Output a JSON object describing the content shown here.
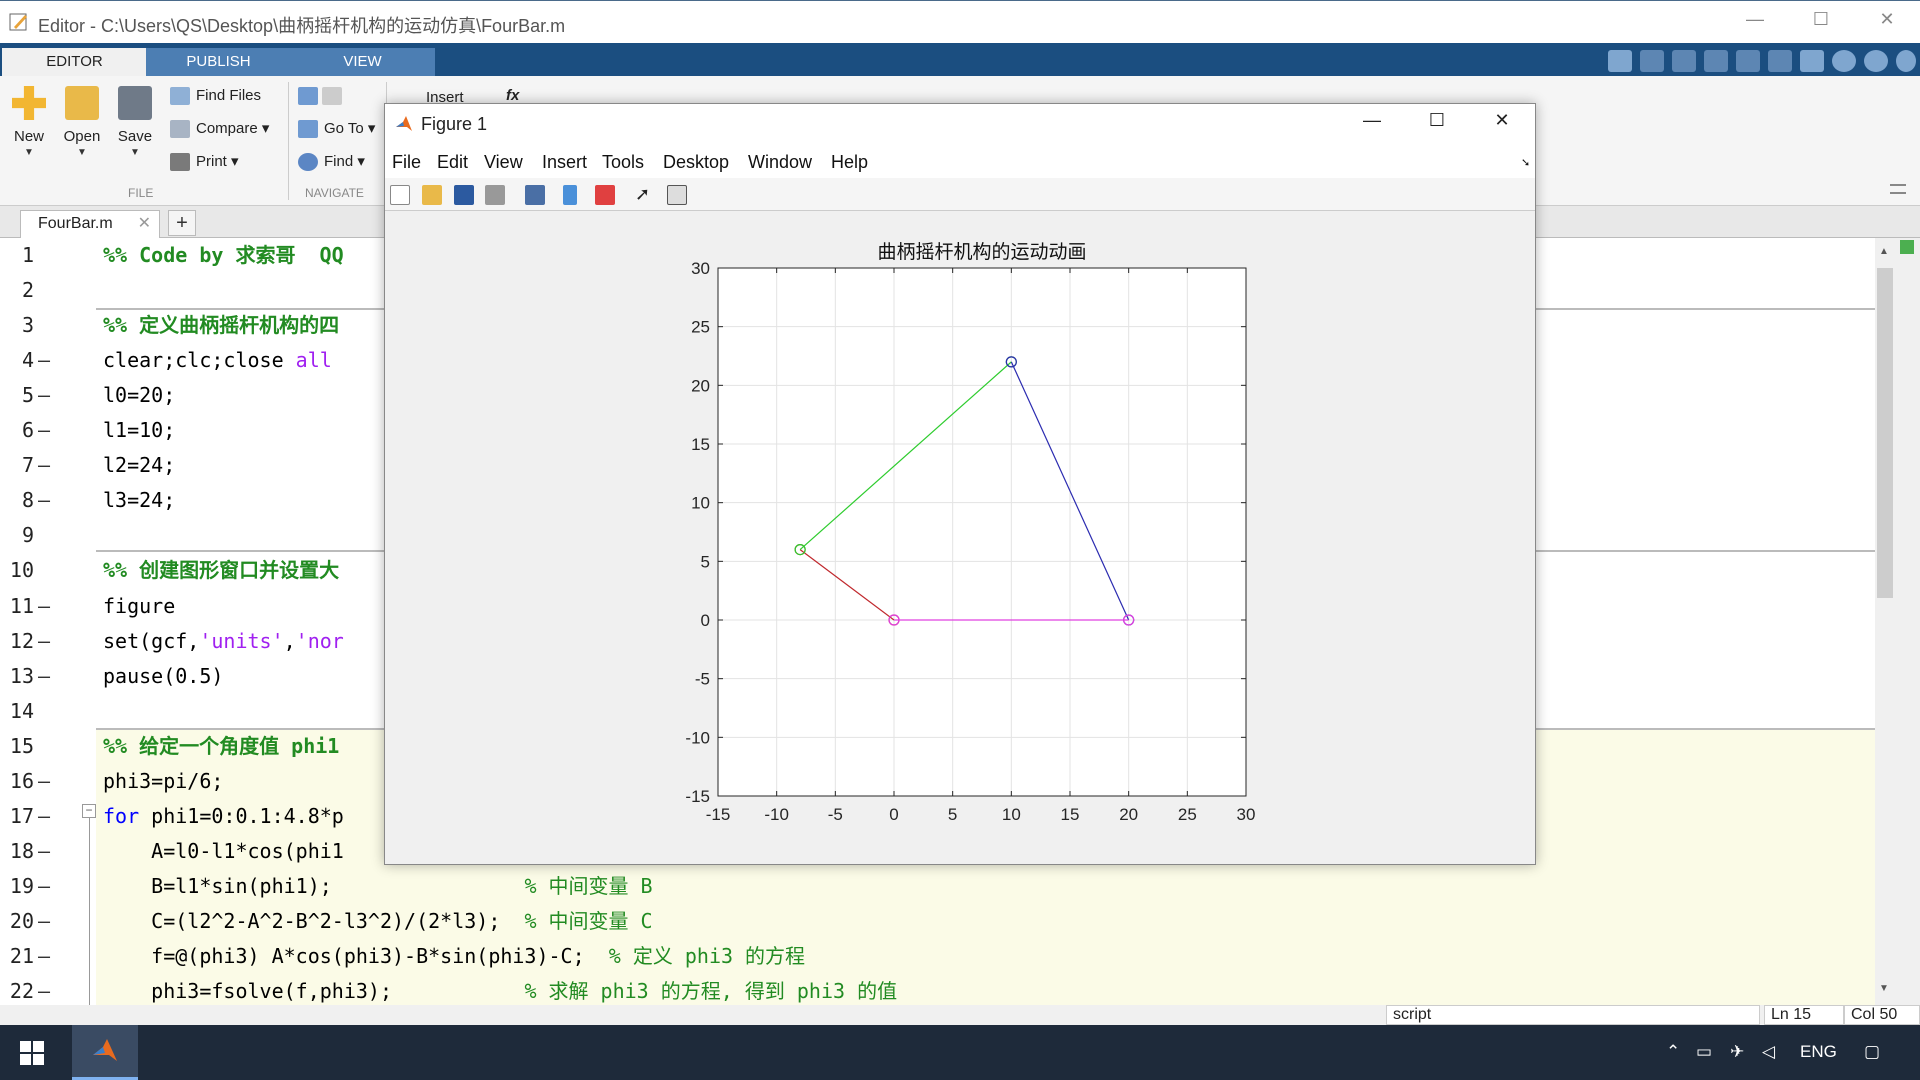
{
  "window": {
    "title": "Editor - C:\\Users\\QS\\Desktop\\曲柄摇杆机构的运动仿真\\FourBar.m",
    "minimize": "—",
    "maximize": "☐",
    "close": "✕"
  },
  "ribbon_tabs": [
    "EDITOR",
    "PUBLISH",
    "VIEW"
  ],
  "ribbon": {
    "new": "New",
    "open": "Open",
    "save": "Save",
    "find_files": "Find Files",
    "compare": "Compare",
    "print": "Print",
    "go_to": "Go To",
    "find": "Find",
    "insert": "Insert",
    "fx": "fx",
    "file_section": "FILE",
    "navigate_section": "NAVIGATE"
  },
  "editor_tab": {
    "name": "FourBar.m",
    "close": "✕",
    "add": "+"
  },
  "code_lines": [
    {
      "n": "1",
      "exec": false,
      "parts": [
        {
          "t": "%% Code by 求索哥  QQ",
          "c": "cell"
        }
      ]
    },
    {
      "n": "2",
      "exec": false,
      "parts": []
    },
    {
      "n": "3",
      "exec": false,
      "parts": [
        {
          "t": "%% 定义曲柄摇杆机构的四",
          "c": "cell"
        }
      ]
    },
    {
      "n": "4",
      "exec": true,
      "parts": [
        {
          "t": "clear;clc;close ",
          "c": ""
        },
        {
          "t": "all",
          "c": "str"
        }
      ]
    },
    {
      "n": "5",
      "exec": true,
      "parts": [
        {
          "t": "l0=20;",
          "c": ""
        }
      ]
    },
    {
      "n": "6",
      "exec": true,
      "parts": [
        {
          "t": "l1=10;",
          "c": ""
        }
      ]
    },
    {
      "n": "7",
      "exec": true,
      "parts": [
        {
          "t": "l2=24;",
          "c": ""
        }
      ]
    },
    {
      "n": "8",
      "exec": true,
      "parts": [
        {
          "t": "l3=24;",
          "c": ""
        }
      ]
    },
    {
      "n": "9",
      "exec": false,
      "parts": []
    },
    {
      "n": "10",
      "exec": false,
      "parts": [
        {
          "t": "%% 创建图形窗口并设置大",
          "c": "cell"
        }
      ]
    },
    {
      "n": "11",
      "exec": true,
      "parts": [
        {
          "t": "figure",
          "c": ""
        }
      ]
    },
    {
      "n": "12",
      "exec": true,
      "parts": [
        {
          "t": "set(gcf,",
          "c": ""
        },
        {
          "t": "'units'",
          "c": "str"
        },
        {
          "t": ",",
          "c": ""
        },
        {
          "t": "'nor",
          "c": "str"
        }
      ]
    },
    {
      "n": "13",
      "exec": true,
      "parts": [
        {
          "t": "pause(0.5)",
          "c": ""
        }
      ]
    },
    {
      "n": "14",
      "exec": false,
      "parts": []
    },
    {
      "n": "15",
      "exec": false,
      "parts": [
        {
          "t": "%% 给定一个角度值 phi1",
          "c": "cell"
        }
      ]
    },
    {
      "n": "16",
      "exec": true,
      "parts": [
        {
          "t": "phi3=pi/6;",
          "c": ""
        }
      ]
    },
    {
      "n": "17",
      "exec": true,
      "parts": [
        {
          "t": "for",
          "c": "kw"
        },
        {
          "t": " phi1=0:0.1:4.8*p",
          "c": ""
        }
      ]
    },
    {
      "n": "18",
      "exec": true,
      "parts": [
        {
          "t": "    A=l0-l1*cos(phi1",
          "c": ""
        }
      ]
    },
    {
      "n": "19",
      "exec": true,
      "parts": [
        {
          "t": "    B=l1*sin(phi1);                ",
          "c": ""
        },
        {
          "t": "% 中间变量 B",
          "c": "cmt"
        }
      ]
    },
    {
      "n": "20",
      "exec": true,
      "parts": [
        {
          "t": "    C=(l2^2-A^2-B^2-l3^2)/(2*l3);  ",
          "c": ""
        },
        {
          "t": "% 中间变量 C",
          "c": "cmt"
        }
      ]
    },
    {
      "n": "21",
      "exec": true,
      "parts": [
        {
          "t": "    f=@(phi3) A*cos(phi3)-B*sin(phi3)-C;  ",
          "c": ""
        },
        {
          "t": "% 定义 phi3 的方程",
          "c": "cmt"
        }
      ]
    },
    {
      "n": "22",
      "exec": true,
      "parts": [
        {
          "t": "    phi3=fsolve(f,phi3);           ",
          "c": ""
        },
        {
          "t": "% 求解 phi3 的方程, 得到 phi3 的值",
          "c": "cmt"
        }
      ]
    }
  ],
  "status": {
    "type": "script",
    "ln": "Ln  15",
    "col": "Col  50"
  },
  "taskbar": {
    "lang": "ENG"
  },
  "figure": {
    "title": "Figure 1",
    "menu": [
      "File",
      "Edit",
      "View",
      "Insert",
      "Tools",
      "Desktop",
      "Window",
      "Help"
    ]
  },
  "chart_data": {
    "type": "line",
    "title": "曲柄摇杆机构的运动动画",
    "xlim": [
      -15,
      30
    ],
    "ylim": [
      -15,
      30
    ],
    "xticks": [
      -15,
      -10,
      -5,
      0,
      5,
      10,
      15,
      20,
      25,
      30
    ],
    "yticks": [
      -15,
      -10,
      -5,
      0,
      5,
      10,
      15,
      20,
      25,
      30
    ],
    "grid": true,
    "series": [
      {
        "points": [
          [
            0,
            0
          ],
          [
            -8,
            6
          ]
        ],
        "color": "#c0282d"
      },
      {
        "points": [
          [
            -8,
            6
          ],
          [
            10,
            22
          ]
        ],
        "color": "#2ecc2e"
      },
      {
        "points": [
          [
            10,
            22
          ],
          [
            20,
            0
          ]
        ],
        "color": "#2b2bb0"
      },
      {
        "points": [
          [
            20,
            0
          ],
          [
            0,
            0
          ]
        ],
        "color": "#e040e0"
      }
    ]
  }
}
